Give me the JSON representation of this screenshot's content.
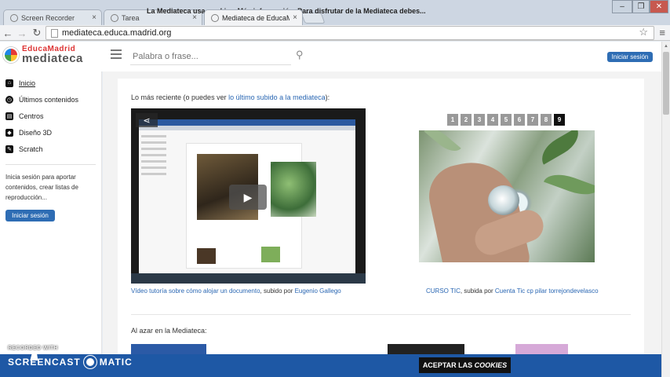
{
  "browser": {
    "tabs": [
      {
        "label": "Screen Recorder",
        "close": "×"
      },
      {
        "label": "Tarea",
        "close": "×"
      },
      {
        "label": "Mediateca de EducaMadr",
        "close": "×"
      }
    ],
    "url": "mediateca.educa.madrid.org",
    "window_buttons": {
      "minimize": "–",
      "restore": "❐",
      "close": "✕"
    }
  },
  "header": {
    "logo_top": "EducaMadrid",
    "logo_bottom": "mediateca",
    "search_placeholder": "Palabra o frase...",
    "login_label": "Iniciar sesión"
  },
  "sidebar": {
    "items": [
      {
        "label": "Inicio",
        "icon": "home-icon"
      },
      {
        "label": "Últimos contenidos",
        "icon": "clock-icon"
      },
      {
        "label": "Centros",
        "icon": "school-icon"
      },
      {
        "label": "Diseño 3D",
        "icon": "cube-icon"
      },
      {
        "label": "Scratch",
        "icon": "scratch-icon"
      }
    ],
    "info_text": "Inicia sesión para aportar contenidos, crear listas de reproducción...",
    "login_label": "Iniciar sesión"
  },
  "main": {
    "recent_prefix": "Lo más reciente (o puedes ver ",
    "recent_link": "lo último subido a la mediateca",
    "recent_suffix": "):",
    "video_caption_link": "Vídeo tutoría sobre cómo alojar un documento",
    "video_caption_mid": ", subido por ",
    "video_caption_author": "Eugenio Gallego",
    "pages": [
      "1",
      "2",
      "3",
      "4",
      "5",
      "6",
      "7",
      "8",
      "9"
    ],
    "active_page": "9",
    "photo_caption_link": "CURSO TIC",
    "photo_caption_mid": ", subida por ",
    "photo_caption_author": "Cuenta Tic cp pilar torrejondevelasco",
    "random_label": "Al azar en la Mediateca:"
  },
  "cookie": {
    "text_start": "La Mediateca usa ",
    "text_cookies": "cookies",
    "text_dot": ". ",
    "more_info": "Más información",
    "text_end": ". Para disfrutar de la Mediateca debes...",
    "accept_label": "ACEPTAR LAS ",
    "accept_em": "COOKIES"
  },
  "watermark": {
    "recorded": "RECORDED WITH",
    "brand_left": "SCREENCAST",
    "brand_right": "MATIC"
  }
}
